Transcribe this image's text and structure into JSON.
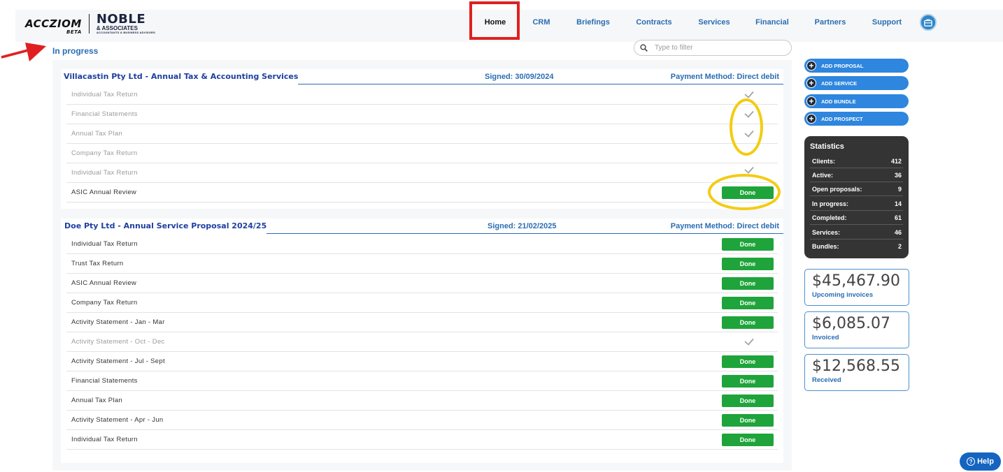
{
  "header": {
    "logo": {
      "primary": "ACCZIOM",
      "beta": "BETA",
      "partner": "NOBLE",
      "partner_sub": "& ASSOCIATES",
      "partner_tag": "ACCOUNTANTS & BUSINESS ADVISORS"
    },
    "nav": [
      {
        "label": "Home",
        "active": true
      },
      {
        "label": "CRM"
      },
      {
        "label": "Briefings"
      },
      {
        "label": "Contracts"
      },
      {
        "label": "Services"
      },
      {
        "label": "Financial"
      },
      {
        "label": "Partners"
      },
      {
        "label": "Support"
      }
    ],
    "account_icon": "briefcase-icon"
  },
  "main": {
    "section_title": "In progress",
    "filter": {
      "placeholder": "Type to filter",
      "value": "",
      "icon": "search-icon"
    },
    "proposals": [
      {
        "title": "Villacastin Pty Ltd - Annual Tax & Accounting Services",
        "signed": "Signed: 30/09/2024",
        "payment": "Payment Method: Direct debit",
        "services": [
          {
            "name": "Individual Tax Return",
            "status": "check",
            "muted": true
          },
          {
            "name": "Financial Statements",
            "status": "check",
            "muted": true
          },
          {
            "name": "Annual Tax Plan",
            "status": "check",
            "muted": true
          },
          {
            "name": "Company Tax Return",
            "status": "none",
            "muted": true
          },
          {
            "name": "Individual Tax Return",
            "status": "check",
            "muted": true
          },
          {
            "name": "ASIC Annual Review",
            "status": "done",
            "muted": false,
            "button": "Done"
          }
        ]
      },
      {
        "title": "Doe Pty Ltd - Annual Service Proposal 2024/25",
        "signed": "Signed: 21/02/2025",
        "payment": "Payment Method: Direct debit",
        "services": [
          {
            "name": "Individual Tax Return",
            "status": "done",
            "muted": false,
            "button": "Done"
          },
          {
            "name": "Trust Tax Return",
            "status": "done",
            "muted": false,
            "button": "Done"
          },
          {
            "name": "ASIC Annual Review",
            "status": "done",
            "muted": false,
            "button": "Done"
          },
          {
            "name": "Company Tax Return",
            "status": "done",
            "muted": false,
            "button": "Done"
          },
          {
            "name": "Activity Statement - Jan - Mar",
            "status": "done",
            "muted": false,
            "button": "Done"
          },
          {
            "name": "Activity Statement - Oct - Dec",
            "status": "check",
            "muted": true
          },
          {
            "name": "Activity Statement - Jul - Sept",
            "status": "done",
            "muted": false,
            "button": "Done"
          },
          {
            "name": "Financial Statements",
            "status": "done",
            "muted": false,
            "button": "Done"
          },
          {
            "name": "Annual Tax Plan",
            "status": "done",
            "muted": false,
            "button": "Done"
          },
          {
            "name": "Activity Statement - Apr - Jun",
            "status": "done",
            "muted": false,
            "button": "Done"
          },
          {
            "name": "Individual Tax Return",
            "status": "done",
            "muted": false,
            "button": "Done"
          }
        ]
      }
    ]
  },
  "sidebar": {
    "actions": [
      {
        "label": "ADD PROPOSAL"
      },
      {
        "label": "ADD SERVICE"
      },
      {
        "label": "ADD BUNDLE"
      },
      {
        "label": "ADD PROSPECT"
      }
    ],
    "statistics": {
      "title": "Statistics",
      "rows": [
        {
          "label": "Clients:",
          "value": "412"
        },
        {
          "label": "Active:",
          "value": "36"
        },
        {
          "label": "Open proposals:",
          "value": "9"
        },
        {
          "label": "In progress:",
          "value": "14"
        },
        {
          "label": "Completed:",
          "value": "61"
        },
        {
          "label": "Services:",
          "value": "46"
        },
        {
          "label": "Bundles:",
          "value": "2"
        }
      ]
    },
    "money": [
      {
        "amount": "$45,467.90",
        "label": "Upcoming invoices"
      },
      {
        "amount": "$6,085.07",
        "label": "Invoiced"
      },
      {
        "amount": "$12,568.55",
        "label": "Received"
      }
    ]
  },
  "help": {
    "label": "Help"
  },
  "colors": {
    "accent": "#2a6db3",
    "done": "#1ea43a",
    "highlight_box": "#e02020",
    "highlight_ellipse": "#f3cc12",
    "stats_bg": "#343434"
  }
}
